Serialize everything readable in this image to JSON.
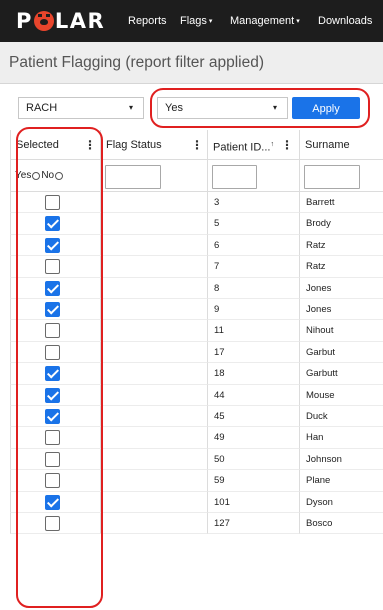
{
  "nav": {
    "logo_text_left": "P",
    "logo_text_right": "LAR",
    "items": [
      {
        "label": "Reports",
        "dropdown": false
      },
      {
        "label": "Flags",
        "dropdown": true
      },
      {
        "label": "Management",
        "dropdown": true
      },
      {
        "label": "Downloads",
        "dropdown": false
      }
    ],
    "dropdown_caret": "▾"
  },
  "page": {
    "title": "Patient Flagging (report filter applied)"
  },
  "filters": {
    "category_select": "RACH",
    "flag_select": "Yes",
    "select_arrow": "▾",
    "apply_label": "Apply"
  },
  "grid": {
    "columns": [
      {
        "label": "Selected",
        "menu": "⋮"
      },
      {
        "label": "Flag Status",
        "menu": "⋮"
      },
      {
        "label": "Patient ID...",
        "sort": "↑",
        "menu": "⋮"
      },
      {
        "label": "Surname"
      }
    ],
    "selected_filter": {
      "yes_label": "Yes",
      "no_label": "No"
    },
    "rows": [
      {
        "selected": false,
        "flag_status": "",
        "patient_id": "3",
        "surname": "Barrett"
      },
      {
        "selected": true,
        "flag_status": "",
        "patient_id": "5",
        "surname": "Brody"
      },
      {
        "selected": true,
        "flag_status": "",
        "patient_id": "6",
        "surname": "Ratz"
      },
      {
        "selected": false,
        "flag_status": "",
        "patient_id": "7",
        "surname": "Ratz"
      },
      {
        "selected": true,
        "flag_status": "",
        "patient_id": "8",
        "surname": "Jones"
      },
      {
        "selected": true,
        "flag_status": "",
        "patient_id": "9",
        "surname": "Jones"
      },
      {
        "selected": false,
        "flag_status": "",
        "patient_id": "11",
        "surname": "Nihout"
      },
      {
        "selected": false,
        "flag_status": "",
        "patient_id": "17",
        "surname": "Garbut"
      },
      {
        "selected": true,
        "flag_status": "",
        "patient_id": "18",
        "surname": "Garbutt"
      },
      {
        "selected": true,
        "flag_status": "",
        "patient_id": "44",
        "surname": "Mouse"
      },
      {
        "selected": true,
        "flag_status": "",
        "patient_id": "45",
        "surname": "Duck"
      },
      {
        "selected": false,
        "flag_status": "",
        "patient_id": "49",
        "surname": "Han"
      },
      {
        "selected": false,
        "flag_status": "",
        "patient_id": "50",
        "surname": "Johnson"
      },
      {
        "selected": false,
        "flag_status": "",
        "patient_id": "59",
        "surname": "Plane"
      },
      {
        "selected": true,
        "flag_status": "",
        "patient_id": "101",
        "surname": "Dyson"
      },
      {
        "selected": false,
        "flag_status": "",
        "patient_id": "127",
        "surname": "Bosco"
      }
    ]
  },
  "colors": {
    "navbar": "#1d1d1d",
    "logo_accent": "#e8452c",
    "primary": "#1a73e8",
    "highlight": "#e02020"
  }
}
